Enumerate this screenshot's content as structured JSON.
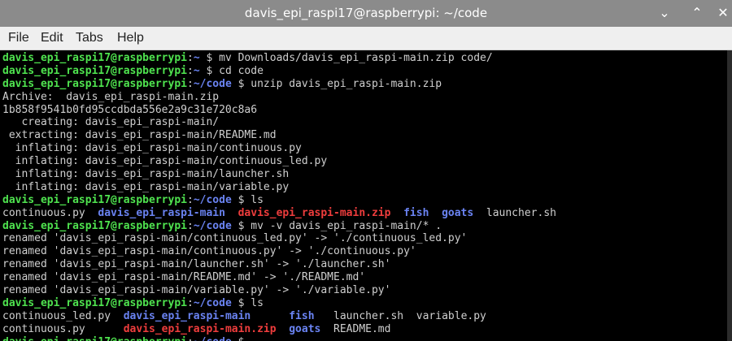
{
  "window": {
    "title": "davis_epi_raspi17@raspberrypi: ~/code",
    "minimize_glyph": "⌄",
    "maximize_glyph": "⌃",
    "close_glyph": "✕"
  },
  "menu": [
    "File",
    "Edit",
    "Tabs",
    "Help"
  ],
  "terminal": {
    "user_host": "davis_epi_raspi17@raspberrypi",
    "prompt_home": "~",
    "prompt_code": "~/code",
    "cmd_mv_zip": "mv Downloads/davis_epi_raspi-main.zip code/",
    "cmd_cd": "cd code",
    "cmd_unzip": "unzip davis_epi_raspi-main.zip",
    "unzip_output": [
      "Archive:  davis_epi_raspi-main.zip",
      "1b858f9541b0fd95ccdbda556e2a9c31e720c8a6",
      "   creating: davis_epi_raspi-main/",
      " extracting: davis_epi_raspi-main/README.md",
      "  inflating: davis_epi_raspi-main/continuous.py",
      "  inflating: davis_epi_raspi-main/continuous_led.py",
      "  inflating: davis_epi_raspi-main/launcher.sh",
      "  inflating: davis_epi_raspi-main/variable.py"
    ],
    "cmd_ls": "ls",
    "ls1": {
      "f1": "continuous.py",
      "d1": "davis_epi_raspi-main",
      "z1": "davis_epi_raspi-main.zip",
      "d2": "fish",
      "d3": "goats",
      "f2": "launcher.sh"
    },
    "cmd_mv_all": "mv -v davis_epi_raspi-main/* .",
    "mv_output": [
      "renamed 'davis_epi_raspi-main/continuous_led.py' -> './continuous_led.py'",
      "renamed 'davis_epi_raspi-main/continuous.py' -> './continuous.py'",
      "renamed 'davis_epi_raspi-main/launcher.sh' -> './launcher.sh'",
      "renamed 'davis_epi_raspi-main/README.md' -> './README.md'",
      "renamed 'davis_epi_raspi-main/variable.py' -> './variable.py'"
    ],
    "ls2_row1": {
      "f1": "continuous_led.py",
      "d1": "davis_epi_raspi-main",
      "d2": "fish",
      "f2": "launcher.sh",
      "f3": "variable.py"
    },
    "ls2_row2": {
      "f1": "continuous.py",
      "z1": "davis_epi_raspi-main.zip",
      "d2": "goats",
      "f2": "README.md"
    }
  },
  "colors": {
    "prompt_user": "#4fe34f",
    "prompt_path": "#6a83f2",
    "directory": "#6a83f2",
    "archive": "#ef3d3d",
    "background": "#000000"
  }
}
